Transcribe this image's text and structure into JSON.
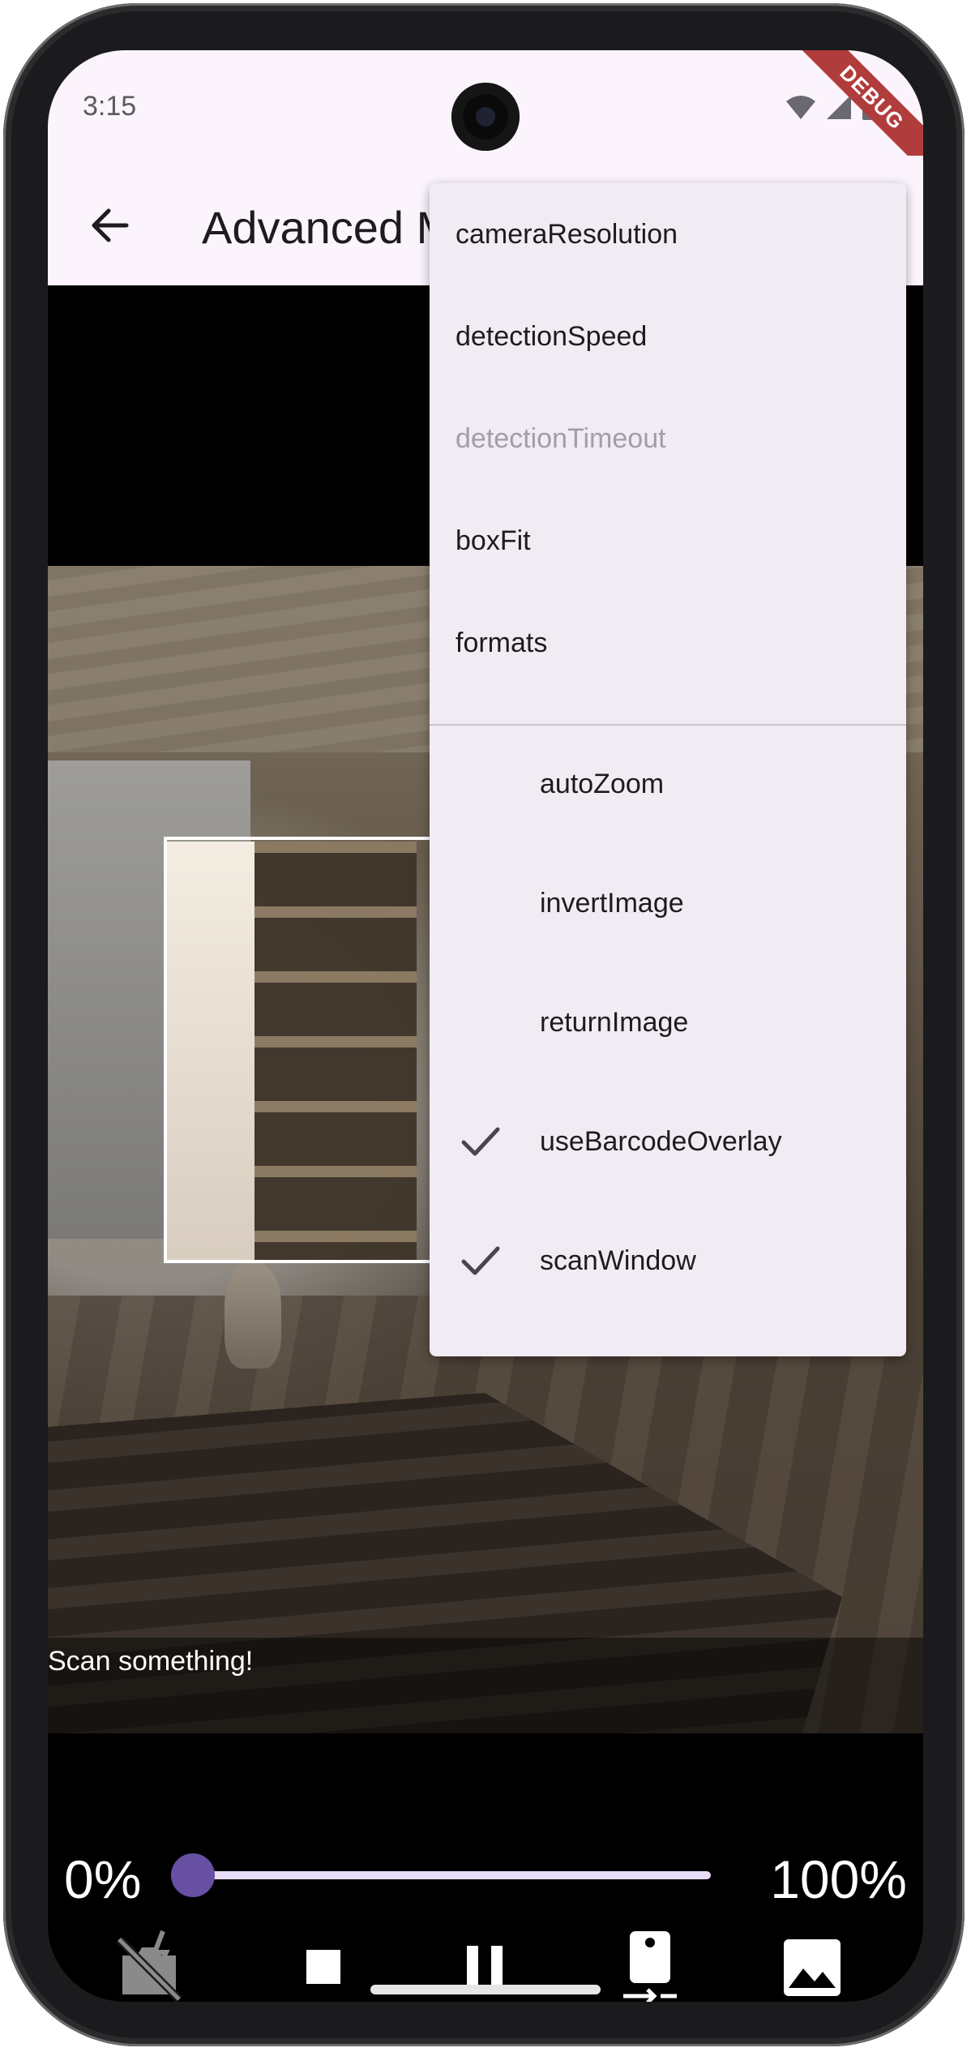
{
  "status_bar": {
    "time": "3:15",
    "debug_label": "DEBUG"
  },
  "app_bar": {
    "title": "Advanced M"
  },
  "menu": {
    "items": [
      {
        "label": "cameraResolution",
        "enabled": true
      },
      {
        "label": "detectionSpeed",
        "enabled": true
      },
      {
        "label": "detectionTimeout",
        "enabled": false
      },
      {
        "label": "boxFit",
        "enabled": true
      },
      {
        "label": "formats",
        "enabled": true
      }
    ],
    "check_items": [
      {
        "label": "autoZoom",
        "checked": false
      },
      {
        "label": "invertImage",
        "checked": false
      },
      {
        "label": "returnImage",
        "checked": false
      },
      {
        "label": "useBarcodeOverlay",
        "checked": true
      },
      {
        "label": "scanWindow",
        "checked": true
      }
    ]
  },
  "scanner": {
    "result_text": "Scan something!"
  },
  "zoom": {
    "min_label": "0%",
    "max_label": "100%",
    "value": 0
  },
  "controls": {
    "icons": [
      "flash-off-icon",
      "stop-icon",
      "pause-icon",
      "switch-camera-icon",
      "gallery-icon"
    ]
  },
  "colors": {
    "app_bar_bg": "#fcf4fd",
    "menu_bg": "#f1ecf4",
    "slider_active": "#6750a4",
    "slider_track": "#e8def8",
    "debug_banner": "#b13c3c"
  }
}
